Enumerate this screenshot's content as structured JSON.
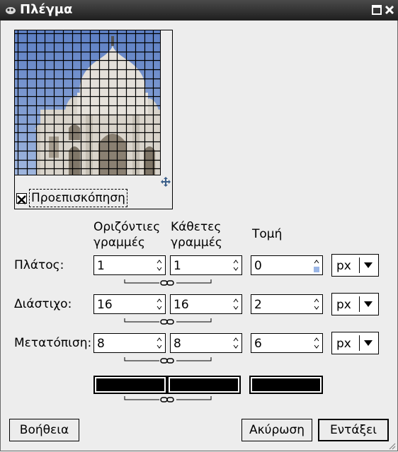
{
  "window": {
    "title": "Πλέγμα"
  },
  "preview": {
    "checkbox_label": "Προεπισκόπηση",
    "checked": true
  },
  "headers": {
    "horizontal": [
      "Οριζόντιες",
      "γραμμές"
    ],
    "vertical": [
      "Κάθετες",
      "γραμμές"
    ],
    "intersection": "Τομή"
  },
  "rows": {
    "width": {
      "label": "Πλάτος:",
      "horizontal": "1",
      "vertical": "1",
      "intersection": "0",
      "unit": "px"
    },
    "spacing": {
      "label": "Διάστιχο:",
      "horizontal": "16",
      "vertical": "16",
      "intersection": "2",
      "unit": "px"
    },
    "offset": {
      "label": "Μετατόπιση:",
      "horizontal": "8",
      "vertical": "8",
      "intersection": "6",
      "unit": "px"
    }
  },
  "colors": {
    "horizontal": "#000000",
    "vertical": "#000000",
    "intersection": "#000000"
  },
  "buttons": {
    "help": "Βοήθεια",
    "cancel": "Ακύρωση",
    "ok": "Εντάξει"
  }
}
